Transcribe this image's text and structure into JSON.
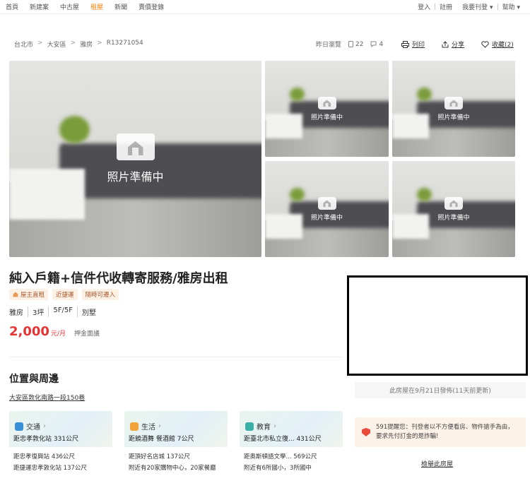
{
  "nav": {
    "left": [
      "首頁",
      "新建案",
      "中古屋",
      "租屋",
      "新聞",
      "賣價登錄"
    ],
    "active_index": 3,
    "right": [
      "登入",
      "註冊",
      "我要刊登",
      "幫助"
    ]
  },
  "breadcrumb": [
    "台北市",
    "大安區",
    "雅房",
    "R13271054"
  ],
  "stats": {
    "viewed": "昨日瀏覽",
    "views": "22",
    "comments": "4"
  },
  "actions": {
    "print": "列印",
    "share": "分享",
    "favorite": "收藏(2)"
  },
  "photo_placeholder": "照片準備中",
  "listing": {
    "title": "純入戶籍+信件代收轉寄服務/雅房出租",
    "tags": [
      "屋主直租",
      "近捷運",
      "隨時可遷入"
    ],
    "attributes": [
      "雅房",
      "3坪",
      "5F/5F",
      "別墅"
    ],
    "price": "2,000",
    "price_unit": "元/月",
    "deposit": "押金面議"
  },
  "location": {
    "section_title": "位置與周邊",
    "address": "大安區敦化南路一段150巷",
    "cards": [
      {
        "label": "交通",
        "color": "#3a8fd9",
        "main": "距忠孝敦化站 331公尺",
        "subs": [
          "距忠孝復興站 436公尺",
          "距捷運忠孝敦化站 137公尺"
        ]
      },
      {
        "label": "生活",
        "color": "#f2a33a",
        "main": "距饒酒舞 餐酒館 7公尺",
        "subs": [
          "距頂好名店城 137公尺",
          "附近有20家購物中心，20家餐廳"
        ]
      },
      {
        "label": "教育",
        "color": "#3bb0a6",
        "main": "距臺北市私立復... 431公尺",
        "subs": [
          "距奧斯頓語文學... 569公尺",
          "附近有6所國小，3所國中"
        ]
      }
    ]
  },
  "sidebar": {
    "post_note": "此房屋在9月21日發佈(11天前更新)",
    "warning": "591提醒您：刊登者以不方便看房、物件搶手為由，要求先付訂金的是詐騙!",
    "report": "檢舉此房屋"
  }
}
